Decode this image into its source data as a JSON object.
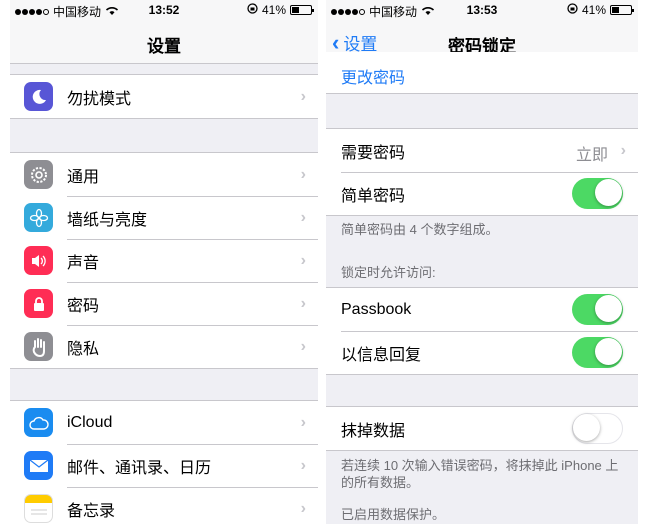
{
  "left": {
    "status": {
      "carrier": "中国移动",
      "time": "13:52",
      "battery": "41%",
      "battery_level": 0.41
    },
    "nav": {
      "title": "设置"
    },
    "group1": [
      {
        "label": "勿扰模式",
        "icon": "moon-icon",
        "color": "#5856d6"
      }
    ],
    "group2": [
      {
        "label": "通用",
        "icon": "gear-icon",
        "color": "#8e8e93"
      },
      {
        "label": "墙纸与亮度",
        "icon": "flower-icon",
        "color": "#34aadc"
      },
      {
        "label": "声音",
        "icon": "speaker-icon",
        "color": "#ff2d55"
      },
      {
        "label": "密码",
        "icon": "lock-icon",
        "color": "#ff2d55"
      },
      {
        "label": "隐私",
        "icon": "hand-icon",
        "color": "#8e8e93"
      }
    ],
    "group3": [
      {
        "label": "iCloud",
        "icon": "cloud-icon",
        "color": "#1a8cf0"
      },
      {
        "label": "邮件、通讯录、日历",
        "icon": "envelope-icon",
        "color": "#1f7bf6"
      },
      {
        "label": "备忘录",
        "icon": "notes-icon",
        "color": "#ffcc00"
      }
    ]
  },
  "right": {
    "status": {
      "carrier": "中国移动",
      "time": "13:53",
      "battery": "41%",
      "battery_level": 0.41
    },
    "nav": {
      "back": "设置",
      "title": "密码锁定"
    },
    "change_passcode": "更改密码",
    "require": {
      "label": "需要密码",
      "value": "立即"
    },
    "simple": {
      "label": "简单密码",
      "on": true
    },
    "simple_footer": "简单密码由 4 个数字组成。",
    "allow_header": "锁定时允许访问:",
    "passbook": {
      "label": "Passbook",
      "on": true
    },
    "reply": {
      "label": "以信息回复",
      "on": true
    },
    "erase": {
      "label": "抹掉数据",
      "on": false
    },
    "erase_footer": "若连续 10 次输入错误密码，将抹掉此 iPhone 上的所有数据。",
    "protect_footer": "已启用数据保护。"
  },
  "colors": {
    "accent": "#1f7bf6",
    "toggle_on": "#4cd964",
    "background": "#efeff4"
  }
}
